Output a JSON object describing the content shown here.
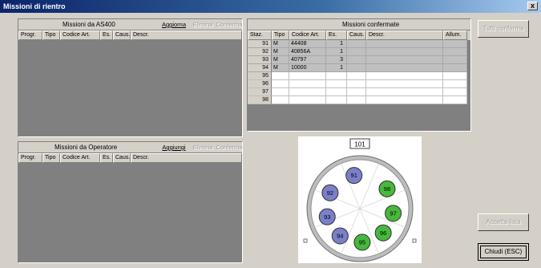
{
  "window": {
    "title": "Missioni di rientro",
    "close_label": "x"
  },
  "as400": {
    "title": "Missioni da AS400",
    "btn_update": "Aggiorna",
    "btn_delete": "Elimina",
    "btn_confirm": "Conferma",
    "columns": [
      "Progr.",
      "Tipo",
      "Codice Art.",
      "Es.",
      "Caus.",
      "Descr."
    ]
  },
  "operator": {
    "title": "Missioni da Operatore",
    "btn_add": "Aggiungi",
    "btn_delete": "Elimina",
    "btn_confirm": "Conferma",
    "columns": [
      "Progr.",
      "Tipo",
      "Codice Art.",
      "Es.",
      "Caus.",
      "Descr."
    ]
  },
  "confirmed": {
    "title": "Missioni confermate",
    "columns": [
      "Staz.",
      "Tipo",
      "Codice Art.",
      "Es.",
      "Caus.",
      "Descr.",
      "Allum."
    ],
    "rows": [
      {
        "staz": "91",
        "tipo": "M",
        "codice": "44408",
        "es": "1",
        "caus": "",
        "descr": "",
        "allum": ""
      },
      {
        "staz": "92",
        "tipo": "M",
        "codice": "40856A",
        "es": "1",
        "caus": "",
        "descr": "",
        "allum": ""
      },
      {
        "staz": "93",
        "tipo": "M",
        "codice": "40797",
        "es": "3",
        "caus": "",
        "descr": "",
        "allum": ""
      },
      {
        "staz": "94",
        "tipo": "M",
        "codice": "10000",
        "es": "1",
        "caus": "",
        "descr": "",
        "allum": ""
      },
      {
        "staz": "95",
        "tipo": "",
        "codice": "",
        "es": "",
        "caus": "",
        "descr": "",
        "allum": ""
      },
      {
        "staz": "96",
        "tipo": "",
        "codice": "",
        "es": "",
        "caus": "",
        "descr": "",
        "allum": ""
      },
      {
        "staz": "97",
        "tipo": "",
        "codice": "",
        "es": "",
        "caus": "",
        "descr": "",
        "allum": ""
      },
      {
        "staz": "98",
        "tipo": "",
        "codice": "",
        "es": "",
        "caus": "",
        "descr": "",
        "allum": ""
      }
    ]
  },
  "buttons": {
    "all_confirm": "Tutti conferma",
    "accept_list": "Accetta lista",
    "close": "Chiudi (ESC)"
  },
  "wheel": {
    "counter": "101",
    "stations": [
      {
        "label": "91",
        "state": "occupied"
      },
      {
        "label": "92",
        "state": "occupied"
      },
      {
        "label": "93",
        "state": "occupied"
      },
      {
        "label": "94",
        "state": "occupied"
      },
      {
        "label": "95",
        "state": "free"
      },
      {
        "label": "96",
        "state": "free"
      },
      {
        "label": "97",
        "state": "free"
      },
      {
        "label": "98",
        "state": "free"
      }
    ],
    "colors": {
      "occupied": "#7b7fc9",
      "free": "#46b83c"
    }
  }
}
